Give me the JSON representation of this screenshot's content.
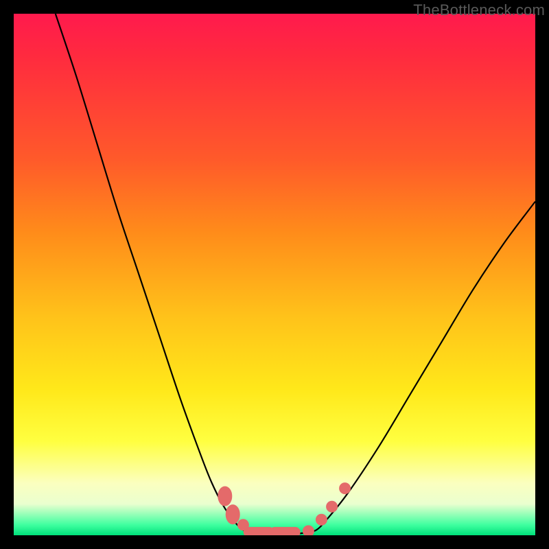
{
  "watermark": "TheBottleneck.com",
  "chart_data": {
    "type": "line",
    "title": "",
    "xlabel": "",
    "ylabel": "",
    "xlim": [
      0,
      100
    ],
    "ylim": [
      0,
      100
    ],
    "series": [
      {
        "name": "left-curve",
        "x": [
          8,
          12,
          16,
          20,
          24,
          28,
          32,
          36,
          38,
          40,
          42,
          44
        ],
        "values": [
          100,
          88,
          75,
          62,
          50,
          38,
          26,
          15,
          10,
          6,
          3,
          1
        ]
      },
      {
        "name": "optimal-flat",
        "x": [
          44,
          46,
          48,
          50,
          52,
          54,
          56,
          58
        ],
        "values": [
          1,
          0.5,
          0.3,
          0.3,
          0.3,
          0.3,
          0.5,
          1
        ]
      },
      {
        "name": "right-curve",
        "x": [
          58,
          60,
          64,
          70,
          76,
          82,
          88,
          94,
          100
        ],
        "values": [
          1,
          3,
          8,
          17,
          27,
          37,
          47,
          56,
          64
        ]
      }
    ],
    "markers": [
      {
        "x": 40.5,
        "y": 7.5,
        "shape": "blob"
      },
      {
        "x": 42.0,
        "y": 4.0,
        "shape": "blob"
      },
      {
        "x": 44.0,
        "y": 2.0,
        "shape": "dot"
      },
      {
        "x": 47.0,
        "y": 0.6,
        "shape": "bar"
      },
      {
        "x": 52.0,
        "y": 0.6,
        "shape": "bar"
      },
      {
        "x": 56.5,
        "y": 0.8,
        "shape": "dot"
      },
      {
        "x": 59.0,
        "y": 3.0,
        "shape": "dot"
      },
      {
        "x": 61.0,
        "y": 5.5,
        "shape": "dot"
      },
      {
        "x": 63.5,
        "y": 9.0,
        "shape": "dot"
      }
    ],
    "gradient_meaning": "background hue encodes bottleneck severity: red=high, green=low"
  }
}
